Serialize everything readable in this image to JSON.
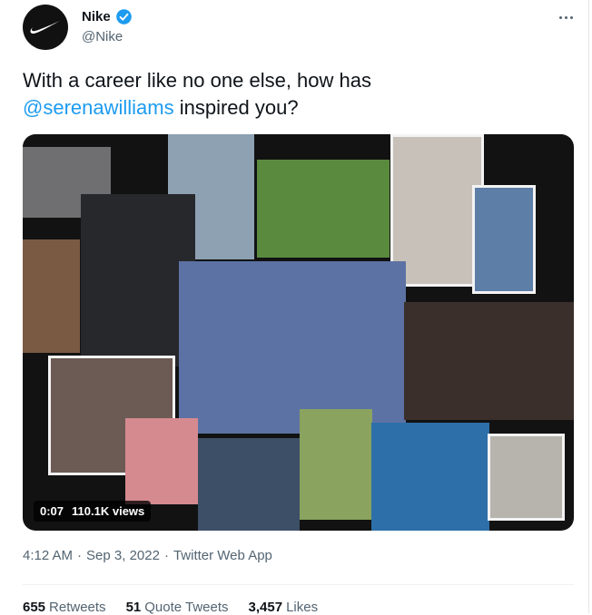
{
  "author": {
    "name": "Nike",
    "handle": "@Nike",
    "verified": true,
    "avatar_icon": "nike-swoosh-icon"
  },
  "tweet": {
    "text_line1": "With a career like no one else, how has",
    "mention": "@serenawilliams",
    "text_after_mention": " inspired you?"
  },
  "media": {
    "type": "video-collage",
    "duration": "0:07",
    "views": "110.1K views"
  },
  "meta": {
    "time": "4:12 AM",
    "date": "Sep 3, 2022",
    "source": "Twitter Web App"
  },
  "stats": [
    {
      "count": "655",
      "label": "Retweets"
    },
    {
      "count": "51",
      "label": "Quote Tweets"
    },
    {
      "count": "3,457",
      "label": "Likes"
    }
  ],
  "colors": {
    "accent": "#1d9bf0",
    "text": "#0f1419",
    "muted": "#536471"
  }
}
